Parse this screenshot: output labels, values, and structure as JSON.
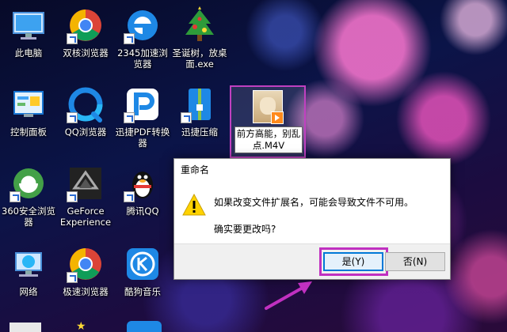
{
  "desktop": {
    "icons": [
      {
        "label": "此电脑",
        "icon": "computer-icon"
      },
      {
        "label": "双核浏览器",
        "icon": "chrome-like-browser-icon"
      },
      {
        "label": "2345加速浏览器",
        "icon": "ie-like-browser-icon"
      },
      {
        "label": "圣诞树，放桌面.exe",
        "icon": "christmas-tree-icon"
      },
      {
        "label": "控制面板",
        "icon": "control-panel-icon"
      },
      {
        "label": "QQ浏览器",
        "icon": "qq-browser-icon"
      },
      {
        "label": "迅捷PDF转换器",
        "icon": "pdf-converter-icon"
      },
      {
        "label": "迅捷压缩",
        "icon": "zip-icon"
      },
      {
        "label": "360安全浏览器",
        "icon": "360-browser-icon"
      },
      {
        "label": "GeForce Experience",
        "icon": "geforce-icon"
      },
      {
        "label": "腾讯QQ",
        "icon": "qq-penguin-icon"
      },
      {
        "label": "网络",
        "icon": "network-icon"
      },
      {
        "label": "极速浏览器",
        "icon": "chrome-browser-icon"
      },
      {
        "label": "酷狗音乐",
        "icon": "kugou-icon"
      }
    ],
    "selected_file": {
      "rename_text": "前方高能，别乱点.M4V",
      "icon": "video-thumbnail-icon"
    }
  },
  "dialog": {
    "title": "重命名",
    "message": "如果改变文件扩展名，可能会导致文件不可用。",
    "question": "确实要更改吗?",
    "yes_label": "是(Y)",
    "no_label": "否(N)",
    "icon": "warning-icon"
  },
  "colors": {
    "highlight": "#c030c0",
    "accent": "#0078d7"
  }
}
